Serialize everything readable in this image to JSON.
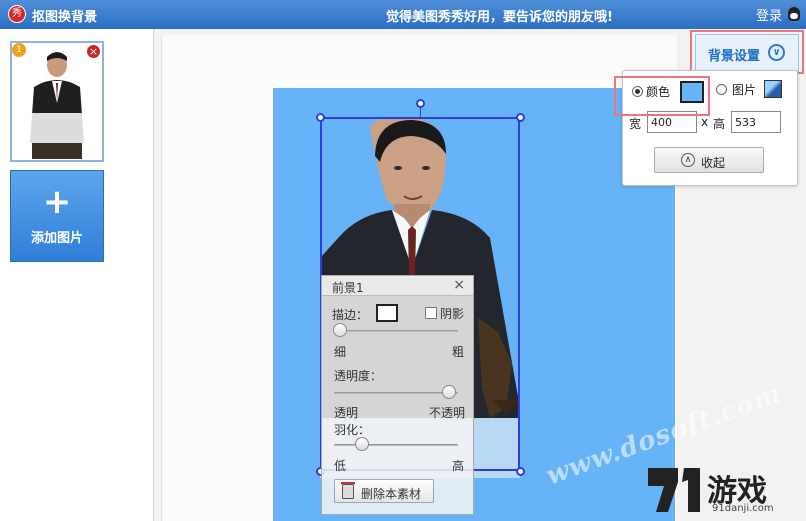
{
  "titlebar": {
    "app_title": "抠图换背景",
    "slogan": "觉得美图秀秀好用，要告诉您的朋友哦!",
    "login": "登录",
    "logo_char": "秀"
  },
  "sidebar": {
    "thumb_number": "1",
    "thumb_close": "×",
    "add_plus": "+",
    "add_label": "添加图片"
  },
  "foreground_panel": {
    "title": "前景1",
    "close": "×",
    "stroke_label": "描边：",
    "shadow_label": "阴影",
    "thin": "细",
    "thick": "粗",
    "opacity_label": "透明度：",
    "transparent": "透明",
    "opaque": "不透明",
    "feather_label": "羽化：",
    "low": "低",
    "high": "高",
    "delete_label": "删除本素材",
    "stroke_level": 0.0,
    "opacity_level": 1.0,
    "feather_level": 0.2
  },
  "bg_settings": {
    "button_label": "背景设置",
    "color_label": "颜色",
    "image_label": "图片",
    "width_label": "宽",
    "width_value": "400",
    "times": "x",
    "height_label": "高",
    "height_value": "533",
    "collapse_label": "收起",
    "selected": "color",
    "bg_color": "#67b3f7"
  },
  "watermark": {
    "text": "www.dosoft.com",
    "logo": "游戏",
    "logo_sub": "91danji.com"
  },
  "colors": {
    "titlebar": "#2c6ec4",
    "canvas_bg": "#67b3f7",
    "selection": "#2c3ee0",
    "highlight": "#e9767a"
  }
}
